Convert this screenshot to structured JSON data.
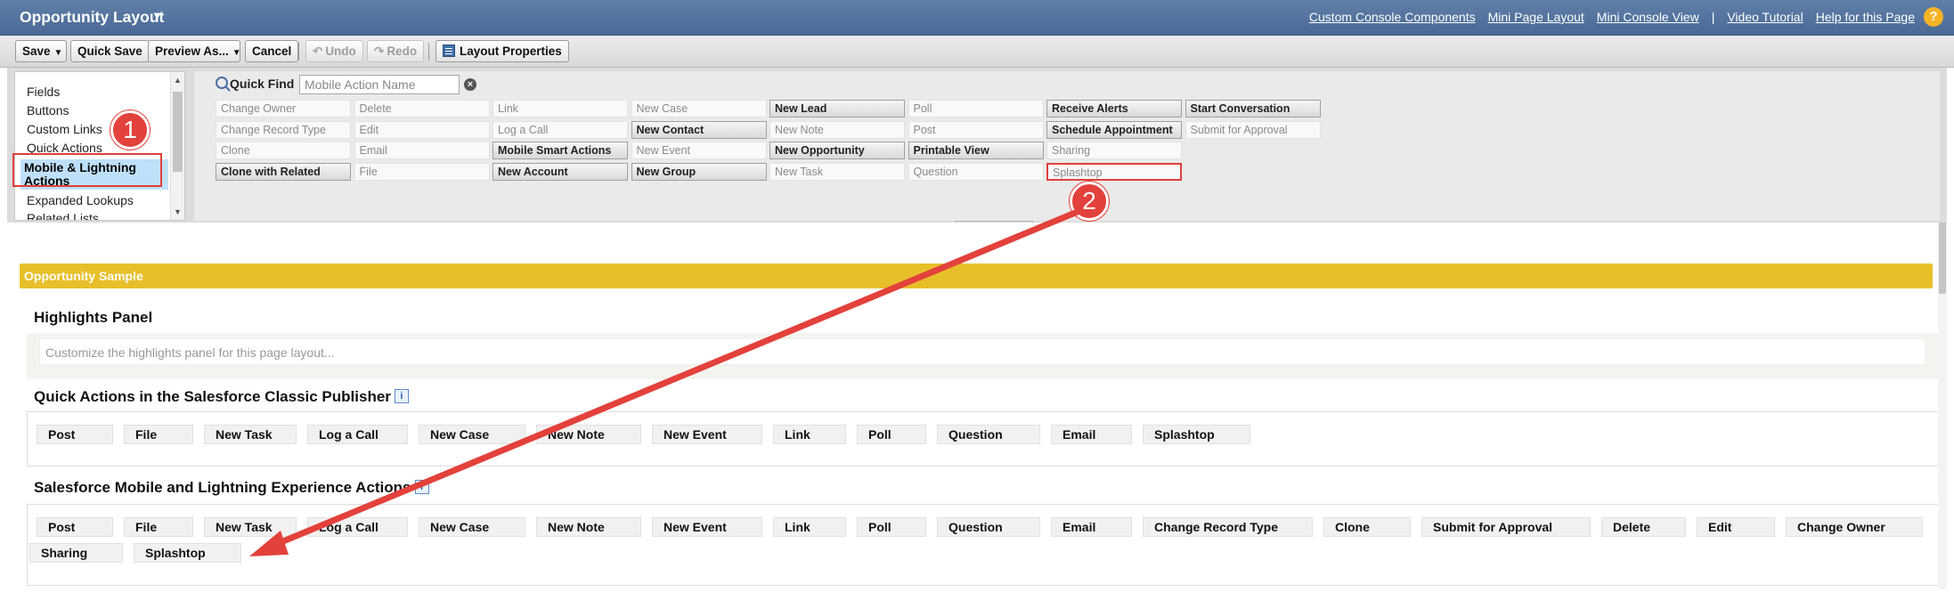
{
  "header": {
    "title": "Opportunity Layout",
    "links": [
      "Custom Console Components",
      "Mini Page Layout",
      "Mini Console View",
      "|",
      "Video Tutorial",
      "Help for this Page"
    ]
  },
  "toolbar": {
    "save": "Save",
    "quick_save": "Quick Save",
    "preview_as": "Preview As...",
    "cancel": "Cancel",
    "undo": "Undo",
    "redo": "Redo",
    "layout_properties": "Layout Properties"
  },
  "palette": {
    "categories": [
      "Fields",
      "Buttons",
      "Custom Links",
      "Quick Actions",
      "Mobile & Lightning Actions",
      "Expanded Lookups",
      "Related Lists"
    ],
    "selected_category": "Mobile & Lightning Actions",
    "quick_find_label": "Quick Find",
    "quick_find_placeholder": "Mobile Action Name",
    "columns": [
      [
        {
          "label": "Change Owner",
          "state": "used"
        },
        {
          "label": "Change Record Type",
          "state": "used"
        },
        {
          "label": "Clone",
          "state": "used"
        },
        {
          "label": "Clone with Related",
          "state": "available"
        }
      ],
      [
        {
          "label": "Delete",
          "state": "used"
        },
        {
          "label": "Edit",
          "state": "used"
        },
        {
          "label": "Email",
          "state": "used"
        },
        {
          "label": "File",
          "state": "used"
        }
      ],
      [
        {
          "label": "Link",
          "state": "used"
        },
        {
          "label": "Log a Call",
          "state": "used"
        },
        {
          "label": "Mobile Smart Actions",
          "state": "available"
        },
        {
          "label": "New Account",
          "state": "available"
        }
      ],
      [
        {
          "label": "New Case",
          "state": "used"
        },
        {
          "label": "New Contact",
          "state": "available"
        },
        {
          "label": "New Event",
          "state": "used"
        },
        {
          "label": "New Group",
          "state": "available"
        }
      ],
      [
        {
          "label": "New Lead",
          "state": "available"
        },
        {
          "label": "New Note",
          "state": "used"
        },
        {
          "label": "New Opportunity",
          "state": "available"
        },
        {
          "label": "New Task",
          "state": "used"
        }
      ],
      [
        {
          "label": "Poll",
          "state": "used"
        },
        {
          "label": "Post",
          "state": "used"
        },
        {
          "label": "Printable View",
          "state": "available"
        },
        {
          "label": "Question",
          "state": "used"
        }
      ],
      [
        {
          "label": "Receive Alerts",
          "state": "available"
        },
        {
          "label": "Schedule Appointment",
          "state": "available"
        },
        {
          "label": "Sharing",
          "state": "used"
        },
        {
          "label": "Splashtop",
          "state": "used"
        }
      ],
      [
        {
          "label": "Start Conversation",
          "state": "available"
        },
        {
          "label": "Submit for Approval",
          "state": "used"
        }
      ]
    ]
  },
  "layout": {
    "sample_header": "Opportunity Sample",
    "highlights": {
      "title": "Highlights Panel",
      "placeholder": "Customize the highlights panel for this page layout..."
    },
    "classic": {
      "title": "Quick Actions in the Salesforce Classic Publisher",
      "info_icon": "i",
      "actions": [
        "Post",
        "File",
        "New Task",
        "Log a Call",
        "New Case",
        "New Note",
        "New Event",
        "Link",
        "Poll",
        "Question",
        "Email",
        "Splashtop"
      ]
    },
    "mobile": {
      "title": "Salesforce Mobile and Lightning Experience Actions",
      "info_icon": "i",
      "actions": [
        "Post",
        "File",
        "New Task",
        "Log a Call",
        "New Case",
        "New Note",
        "New Event",
        "Link",
        "Poll",
        "Question",
        "Email",
        "Change Record Type",
        "Clone",
        "Submit for Approval",
        "Delete",
        "Edit",
        "Change Owner",
        "Sharing",
        "Splashtop"
      ]
    }
  },
  "annotations": {
    "step1": "1",
    "step2": "2",
    "color": "#e3413b"
  }
}
